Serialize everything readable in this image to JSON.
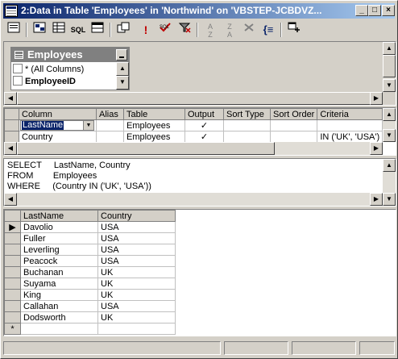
{
  "window": {
    "title": "2:Data in Table 'Employees' in 'Northwind' on 'VBSTEP-JCBDVZ..."
  },
  "toolbar": {
    "icons": [
      "properties-icon",
      "show-diagram-icon",
      "show-grid-icon",
      "show-sql-icon",
      "show-results-icon",
      "change-query-type-icon",
      "run-icon",
      "verify-sql-icon",
      "remove-filter-icon",
      "sort-ascending-icon",
      "sort-descending-icon",
      "group-by-icon",
      "add-table-icon"
    ],
    "sql_label": "SQL"
  },
  "diagram": {
    "table_name": "Employees",
    "rows": [
      "* (All Columns)",
      "EmployeeID"
    ]
  },
  "grid": {
    "headers": [
      "Column",
      "Alias",
      "Table",
      "Output",
      "Sort Type",
      "Sort Order",
      "Criteria"
    ],
    "rows": [
      {
        "column": "LastName",
        "alias": "",
        "table": "Employees",
        "output": "✓",
        "sort_type": "",
        "sort_order": "",
        "criteria": ""
      },
      {
        "column": "Country",
        "alias": "",
        "table": "Employees",
        "output": "✓",
        "sort_type": "",
        "sort_order": "",
        "criteria": "IN ('UK', 'USA')"
      }
    ]
  },
  "sql": {
    "line1": "SELECT     LastName, Country",
    "line2": "FROM        Employees",
    "line3": "WHERE     (Country IN ('UK', 'USA'))"
  },
  "results": {
    "headers": [
      "LastName",
      "Country"
    ],
    "rows": [
      [
        "Davolio",
        "USA"
      ],
      [
        "Fuller",
        "USA"
      ],
      [
        "Leverling",
        "USA"
      ],
      [
        "Peacock",
        "USA"
      ],
      [
        "Buchanan",
        "UK"
      ],
      [
        "Suyama",
        "UK"
      ],
      [
        "King",
        "UK"
      ],
      [
        "Callahan",
        "USA"
      ],
      [
        "Dodsworth",
        "UK"
      ]
    ],
    "new_row_marker": "*",
    "current_row_marker": "▶"
  }
}
